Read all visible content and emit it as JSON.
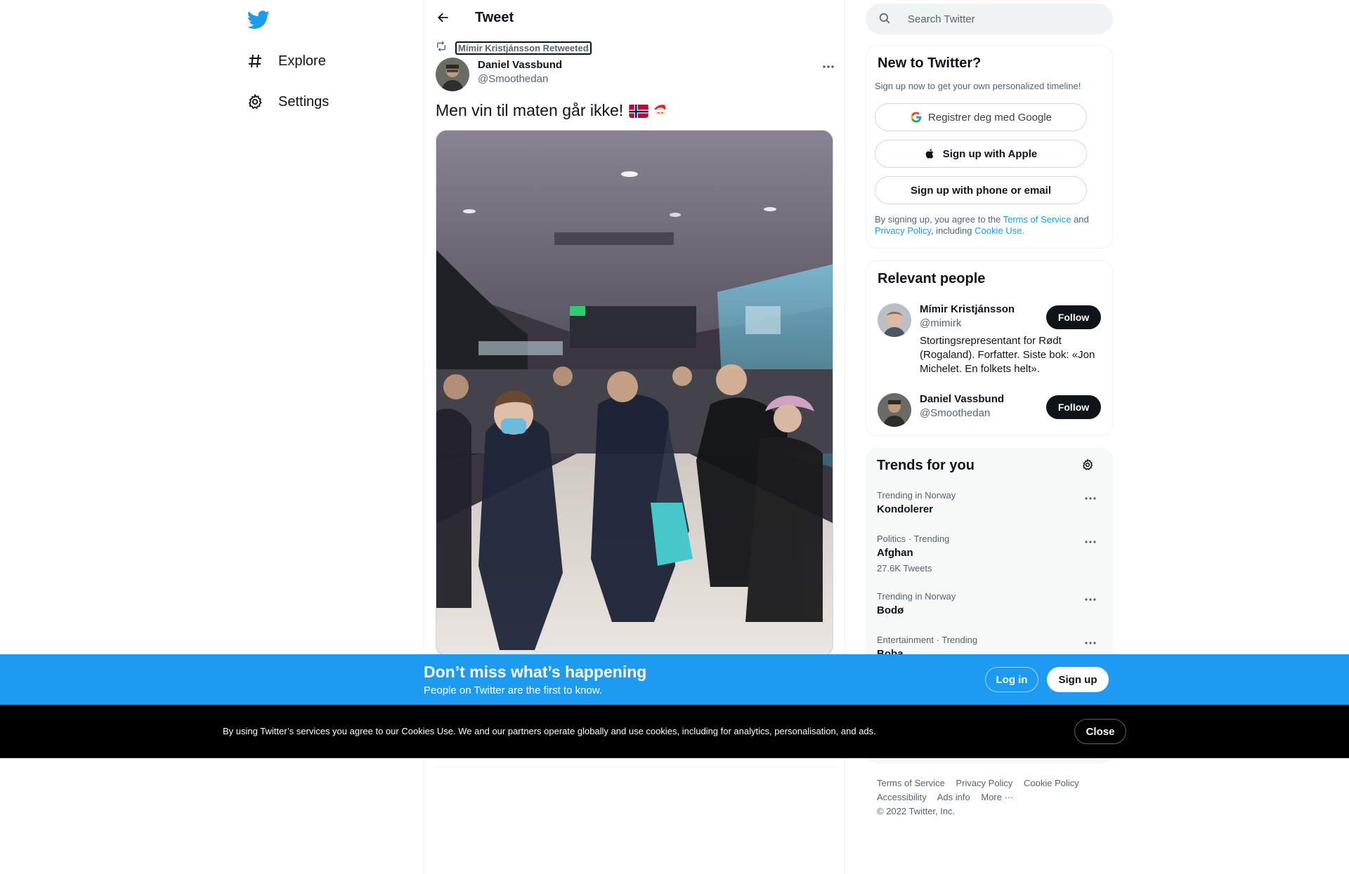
{
  "nav": {
    "logo_icon": "twitter-bird-icon",
    "items": [
      {
        "label": "Explore",
        "icon": "hashtag-icon"
      },
      {
        "label": "Settings",
        "icon": "gear-icon"
      }
    ]
  },
  "header": {
    "title": "Tweet",
    "back_icon": "arrow-left-icon"
  },
  "tweet": {
    "retweet_label": "Mímir Kristjánsson Retweeted",
    "author_name": "Daniel Vassbund",
    "author_handle": "@Smoothedan",
    "text": "Men vin til maten går ikke!",
    "emojis": [
      "norway-flag-icon",
      "santa-icon"
    ],
    "media_icon": "photo-crowd-in-mall"
  },
  "search": {
    "placeholder": "Search Twitter"
  },
  "new_to_twitter": {
    "title": "New to Twitter?",
    "subtitle": "Sign up now to get your own personalized timeline!",
    "google_label": "Registrer deg med Google",
    "apple_label": "Sign up with Apple",
    "phone_label": "Sign up with phone or email",
    "legal_prefix": "By signing up, you agree to the",
    "terms_label": "Terms of Service",
    "legal_and": "and",
    "privacy_label": "Privacy Policy",
    "legal_including": ", including",
    "cookie_label": "Cookie Use."
  },
  "relevant_people": {
    "title": "Relevant people",
    "people": [
      {
        "name": "Mímir Kristjánsson",
        "handle": "@mimirk",
        "bio": "Stortingsrepresentant for Rødt (Rogaland). Forfatter. Siste bok: «Jon Michelet. En folkets helt».",
        "follow_label": "Follow"
      },
      {
        "name": "Daniel Vassbund",
        "handle": "@Smoothedan",
        "follow_label": "Follow"
      }
    ]
  },
  "trends": {
    "title": "Trends for you",
    "items": [
      {
        "meta": "Trending in Norway",
        "name": "Kondolerer"
      },
      {
        "meta": "Politics · Trending",
        "name": "Afghan",
        "count": "27.6K Tweets"
      },
      {
        "meta": "Trending in Norway",
        "name": "Bodø"
      },
      {
        "meta": "Entertainment · Trending",
        "name": "Boba"
      }
    ]
  },
  "footer": {
    "links": [
      "Terms of Service",
      "Privacy Policy",
      "Cookie Policy",
      "Accessibility",
      "Ads info",
      "More ···"
    ],
    "copyright": "© 2022 Twitter, Inc."
  },
  "login_bar": {
    "title": "Don’t miss what’s happening",
    "subtitle": "People on Twitter are the first to know.",
    "login_label": "Log in",
    "signup_label": "Sign up"
  },
  "cookie_bar": {
    "text": "By using Twitter’s services you agree to our Cookies Use. We and our partners operate globally and use cookies, including for analytics, personalisation, and ads.",
    "close_label": "Close"
  },
  "colors": {
    "brand": "#1d9bf0",
    "text": "#0f1419",
    "secondary": "#536471",
    "cookie_bg": "#000000"
  }
}
